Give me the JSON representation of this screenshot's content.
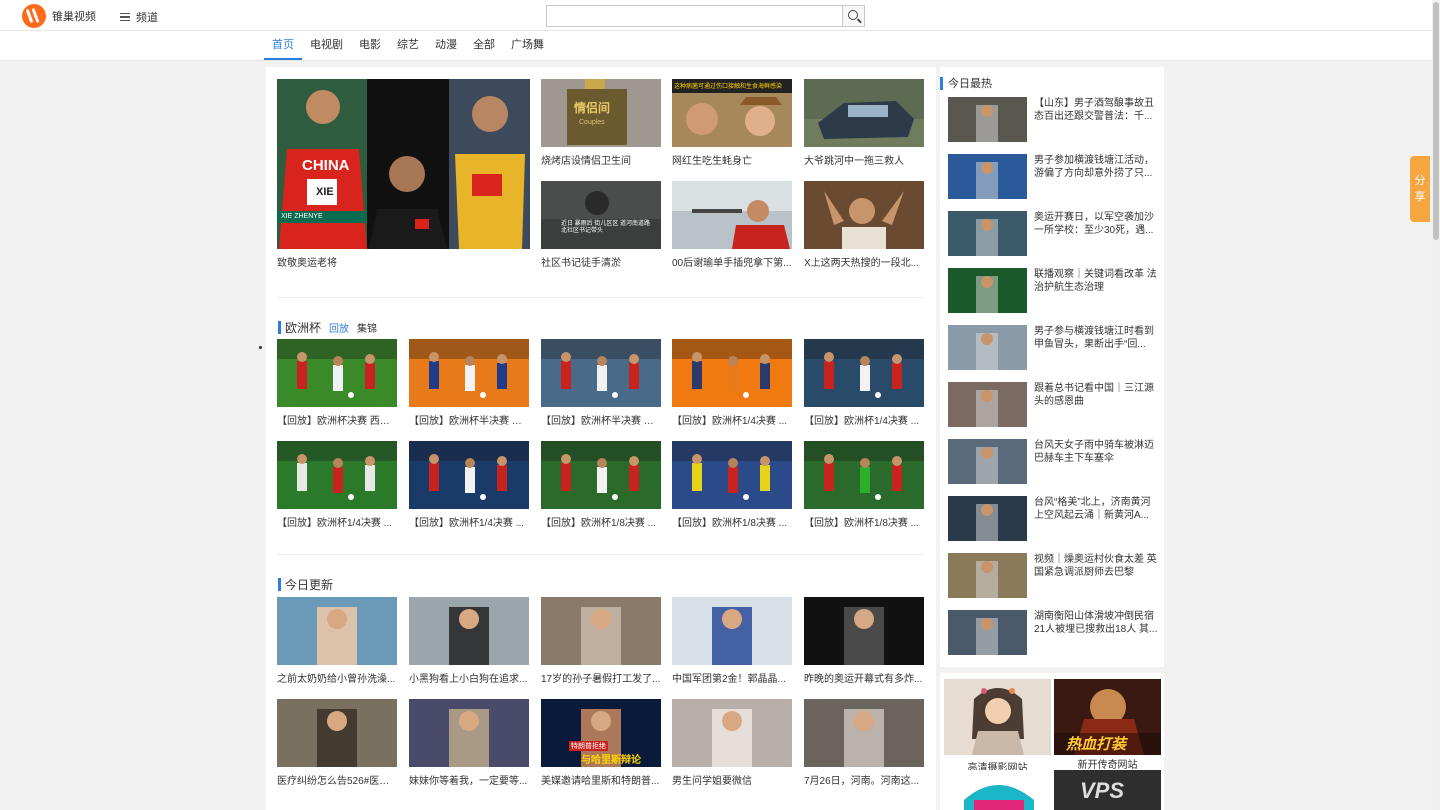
{
  "header": {
    "logo_text": "锥巢视频",
    "channel_label": "频道",
    "search_placeholder": "",
    "search_value": ""
  },
  "nav": {
    "items": [
      "首页",
      "电视剧",
      "电影",
      "综艺",
      "动漫",
      "全部",
      "广场舞"
    ],
    "active": "首页"
  },
  "featured": {
    "big": {
      "caption": "致敬奥运老将",
      "overlay": "CHINA",
      "name_tag": "XIE ZHENYE",
      "bib": "XIE"
    },
    "grid": [
      {
        "caption": "烧烤店设情侣卫生间",
        "sign": "情侣间",
        "sub": "Couples"
      },
      {
        "caption": "网红生吃生蚝身亡",
        "banner": "这种病菌可通过伤口接触和生食海鲜感染"
      },
      {
        "caption": "大爷跳河中一拖三救人"
      },
      {
        "caption": "社区书记徒手清淤",
        "text": "近日 暴雨后 街儿区区 道河南道路北社区书记带头"
      },
      {
        "caption": "00后谢瑜单手插兜拿下第..."
      },
      {
        "caption": "X上这两天热搜的一段北..."
      }
    ]
  },
  "euro": {
    "title": "欧洲杯",
    "tabs": [
      "回放",
      "集锦"
    ],
    "active_tab": "回放",
    "items": [
      {
        "caption": "【回放】欧洲杯决赛 西班..."
      },
      {
        "caption": "【回放】欧洲杯半决赛 荷..."
      },
      {
        "caption": "【回放】欧洲杯半决赛 西..."
      },
      {
        "caption": "【回放】欧洲杯1/4决赛 ..."
      },
      {
        "caption": "【回放】欧洲杯1/4决赛 ..."
      },
      {
        "caption": "【回放】欧洲杯1/4决赛 ..."
      },
      {
        "caption": "【回放】欧洲杯1/4决赛 ..."
      },
      {
        "caption": "【回放】欧洲杯1/8决赛 ..."
      },
      {
        "caption": "【回放】欧洲杯1/8决赛 ..."
      },
      {
        "caption": "【回放】欧洲杯1/8决赛 ..."
      }
    ]
  },
  "today": {
    "title": "今日更新",
    "items": [
      {
        "caption": "之前太奶奶给小曾孙洗澡..."
      },
      {
        "caption": "小黑狗看上小白狗在追求..."
      },
      {
        "caption": "17岁的孙子暑假打工发了..."
      },
      {
        "caption": "中国军团第2金！郭晶晶..."
      },
      {
        "caption": "昨晚的奥运开幕式有多炸..."
      },
      {
        "caption": "医疗纠纷怎么告526#医美..."
      },
      {
        "caption": "妹妹你等着我，一定要等..."
      },
      {
        "caption": "美媒邀请哈里斯和特朗普...",
        "overlay_top": "特朗普拒绝",
        "overlay_bottom": "与哈里斯辩论"
      },
      {
        "caption": "男生问学姐要微信"
      },
      {
        "caption": "7月26日，河南。河南这..."
      }
    ]
  },
  "sidebar": {
    "title": "今日最热",
    "items": [
      {
        "text": "【山东】男子酒驾酿事故丑态百出还跟交警普法：千..."
      },
      {
        "text": "男子参加横渡钱塘江活动，游偏了方向却意外捞了只..."
      },
      {
        "text": "奥运开赛日，以军空袭加沙一所学校：至少30死，遇..."
      },
      {
        "text": "联播观察｜关键词看改革 法治护航生态治理"
      },
      {
        "text": "男子参与横渡钱塘江时看到甲鱼冒头，果断出手“回..."
      },
      {
        "text": "跟着总书记看中国｜三江源头的感恩曲"
      },
      {
        "text": "台风天女子雨中骑车被淋迈巴赫车主下车塞伞"
      },
      {
        "text": "台风“格美”北上，济南黄河上空风起云涌｜新黄河A..."
      },
      {
        "text": "视频｜燥奥运村伙食太差 英国紧急调派厨师去巴黎"
      },
      {
        "text": "湖南衡阳山体滑坡冲倒民宿21人被埋已搜救出18人 其..."
      }
    ]
  },
  "ads": [
    {
      "caption": "高清摄影网站"
    },
    {
      "caption": "新开传奇网站",
      "overlay": "热血打装"
    },
    {
      "caption": ""
    },
    {
      "caption": "",
      "overlay": "VPS"
    }
  ],
  "share_label": "分享",
  "colors": {
    "accent": "#2b7de0",
    "share": "#f6a640",
    "logo": "#ff6a1a"
  }
}
